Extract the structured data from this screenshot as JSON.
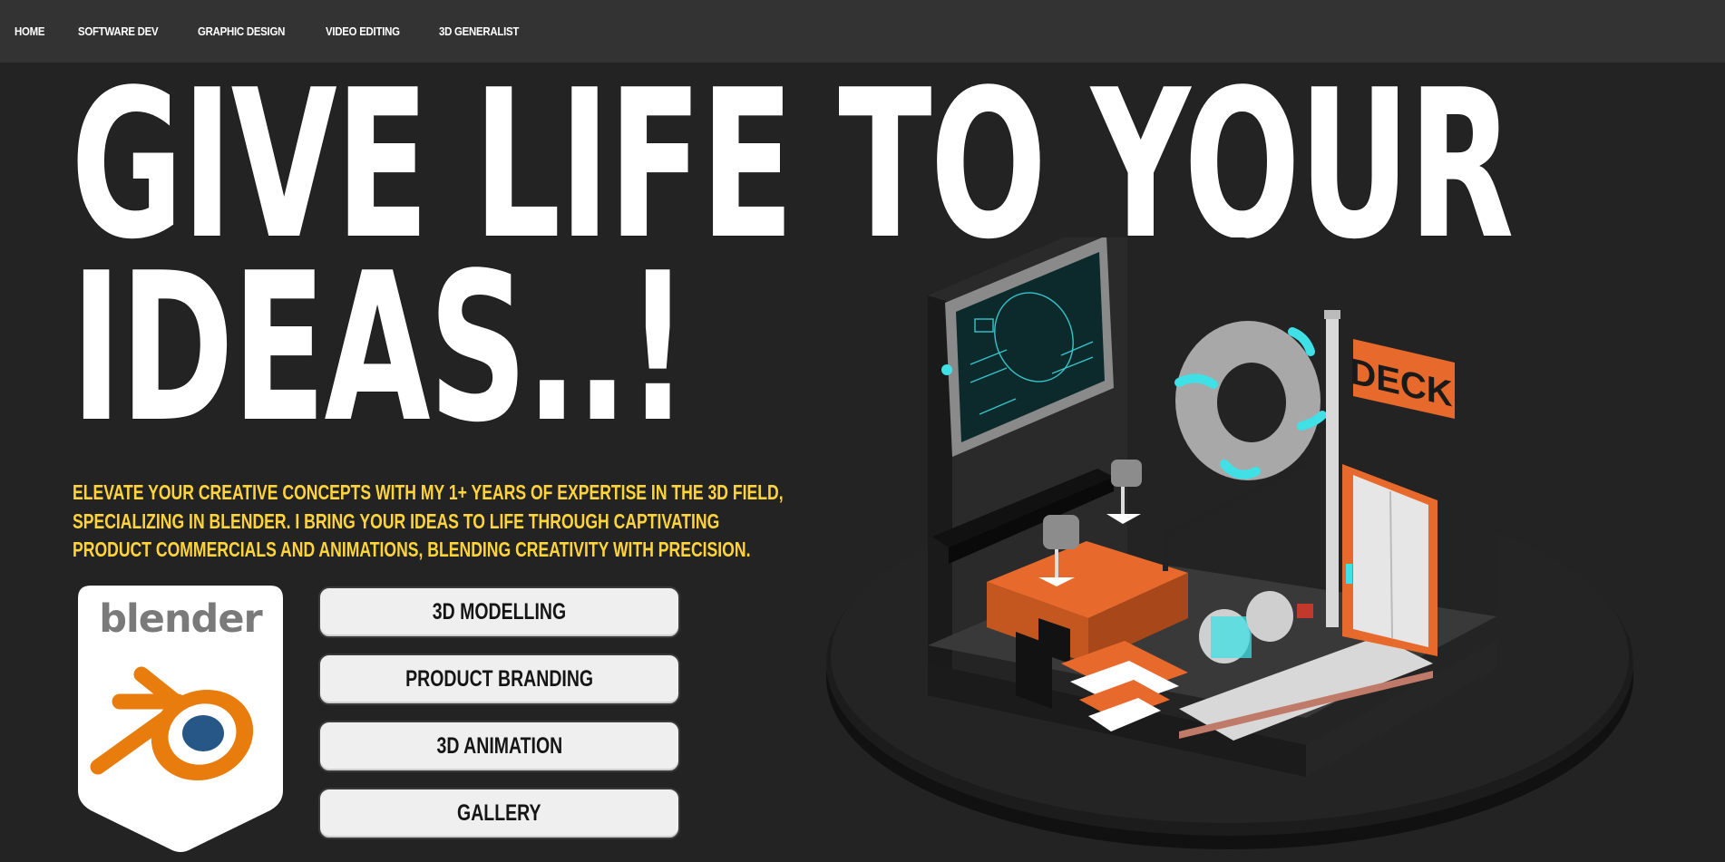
{
  "nav": {
    "items": [
      {
        "label": "HOME"
      },
      {
        "label": "SOFTWARE DEV"
      },
      {
        "label": "GRAPHIC DESIGN"
      },
      {
        "label": "VIDEO EDITING"
      },
      {
        "label": "3D GENERALIST"
      }
    ]
  },
  "hero": {
    "headline_line1": "GIVE LIFE TO YOUR",
    "headline_line2": "IDEAS..!",
    "tagline_lines": [
      "ELEVATE YOUR CREATIVE CONCEPTS WITH MY 1+ YEARS OF EXPERTISE IN THE 3D FIELD,",
      "SPECIALIZING IN BLENDER. I BRING YOUR IDEAS TO LIFE THROUGH CAPTIVATING",
      "PRODUCT COMMERCIALS AND ANIMATIONS, BLENDING CREATIVITY WITH PRECISION."
    ]
  },
  "badge": {
    "logo_text": "blender"
  },
  "services": [
    {
      "label": "3D MODELLING"
    },
    {
      "label": "PRODUCT BRANDING"
    },
    {
      "label": "3D ANIMATION"
    },
    {
      "label": "GALLERY"
    }
  ],
  "scene": {
    "sign_text": "DECK"
  },
  "colors": {
    "background": "#232323",
    "nav_background": "#333333",
    "headline": "#ffffff",
    "tagline": "#ffd43b",
    "button_bg": "#efefef",
    "accent_orange": "#e8692c",
    "accent_cyan": "#3fe0e6",
    "blender_blue": "#265787"
  }
}
